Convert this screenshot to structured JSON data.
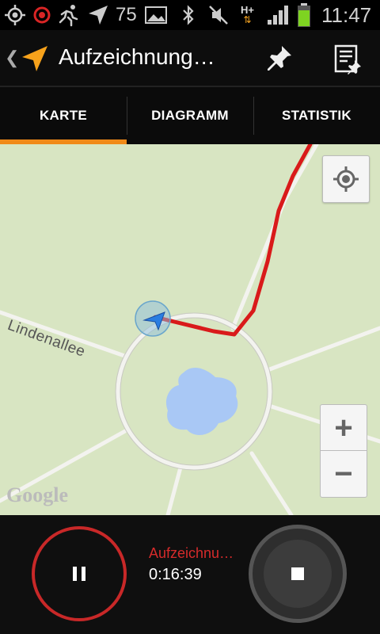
{
  "status_bar": {
    "icons": [
      "gps-icon",
      "record-icon",
      "runner-icon",
      "navigation-icon",
      "image-icon",
      "bluetooth-icon",
      "mute-icon",
      "data-hplus-icon",
      "signal-icon",
      "battery-icon"
    ],
    "notification_count": "75",
    "network_label": "H+",
    "time": "11:47"
  },
  "action_bar": {
    "title": "Aufzeichnung…",
    "accent_color": "#f7a21b"
  },
  "tabs": [
    {
      "label": "KARTE",
      "active": true
    },
    {
      "label": "DIAGRAMM",
      "active": false
    },
    {
      "label": "STATISTIK",
      "active": false
    }
  ],
  "map": {
    "street_name": "Lindenallee",
    "provider_logo": "Google",
    "zoom_in_glyph": "+",
    "zoom_out_glyph": "−",
    "track_color": "#d91a1a",
    "water_color": "#a9c8f5",
    "land_color": "#d8e5c2"
  },
  "controls": {
    "status_label": "Aufzeichnu…",
    "elapsed_time": "0:16:39",
    "pause_ring_color": "#c82828"
  }
}
